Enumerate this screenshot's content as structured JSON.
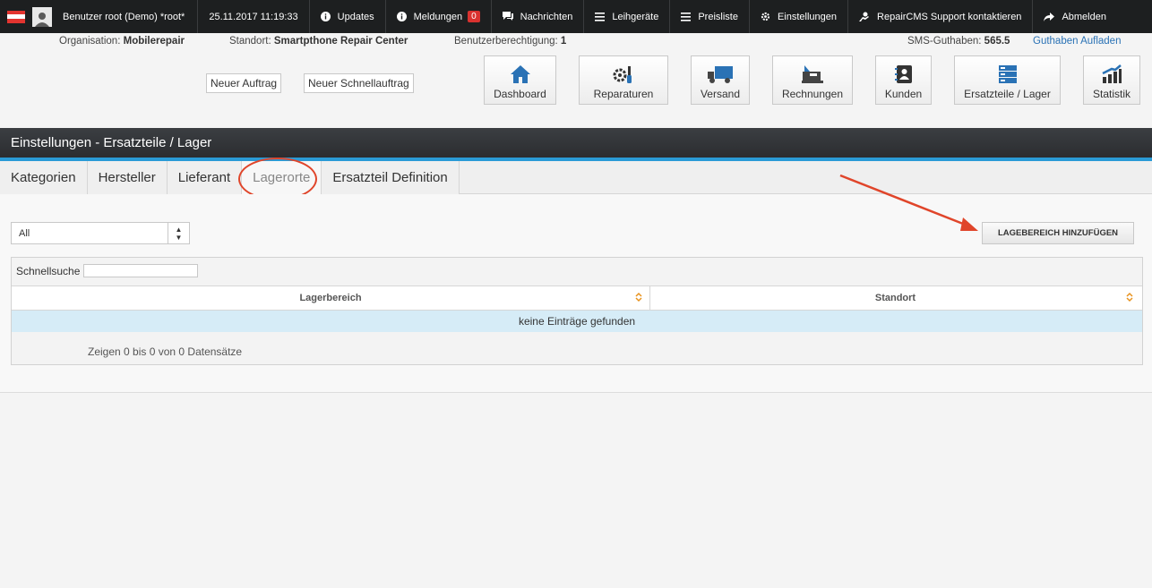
{
  "topbar": {
    "user": "Benutzer root (Demo) *root*",
    "datetime": "25.11.2017 11:19:33",
    "updates": "Updates",
    "meldungen": "Meldungen",
    "meldungen_count": "0",
    "nachrichten": "Nachrichten",
    "leihgeraete": "Leihgeräte",
    "preisliste": "Preisliste",
    "einstellungen": "Einstellungen",
    "support": "RepairCMS Support kontaktieren",
    "abmelden": "Abmelden"
  },
  "info": {
    "org_label": "Organisation:",
    "org_value": "Mobilerepair",
    "standort_label": "Standort:",
    "standort_value": "Smartpthone Repair Center",
    "berechtigung_label": "Benutzerberechtigung:",
    "berechtigung_value": "1",
    "sms_label": "SMS-Guthaben:",
    "sms_value": "565.5",
    "guthaben_link": "Guthaben Aufladen"
  },
  "quick": {
    "neuer_auftrag": "Neuer Auftrag",
    "neuer_schnellauftrag": "Neuer Schnellauftrag"
  },
  "nav": {
    "dashboard": "Dashboard",
    "reparaturen": "Reparaturen",
    "versand": "Versand",
    "rechnungen": "Rechnungen",
    "kunden": "Kunden",
    "ersatzteile": "Ersatzteile / Lager",
    "statistik": "Statistik"
  },
  "section_title": "Einstellungen - Ersatzteile / Lager",
  "tabs": [
    "Kategorien",
    "Hersteller",
    "Lieferant",
    "Lagerorte",
    "Ersatzteil Definition"
  ],
  "filter": {
    "selected": "All"
  },
  "add_button": "LAGEBEREICH HINZUFÜGEN",
  "table": {
    "search_label": "Schnellsuche",
    "columns": [
      "Lagerbereich",
      "Standort"
    ],
    "empty_text": "keine Einträge gefunden",
    "info_text": "Zeigen 0 bis 0 von 0 Datensätze"
  },
  "colors": {
    "topbar": "#1d1f20",
    "accent_blue": "#2a9bd6",
    "annotation_red": "#e0452a",
    "badge_red": "#d9322f",
    "nav_icon_blue": "#2a72b5"
  }
}
